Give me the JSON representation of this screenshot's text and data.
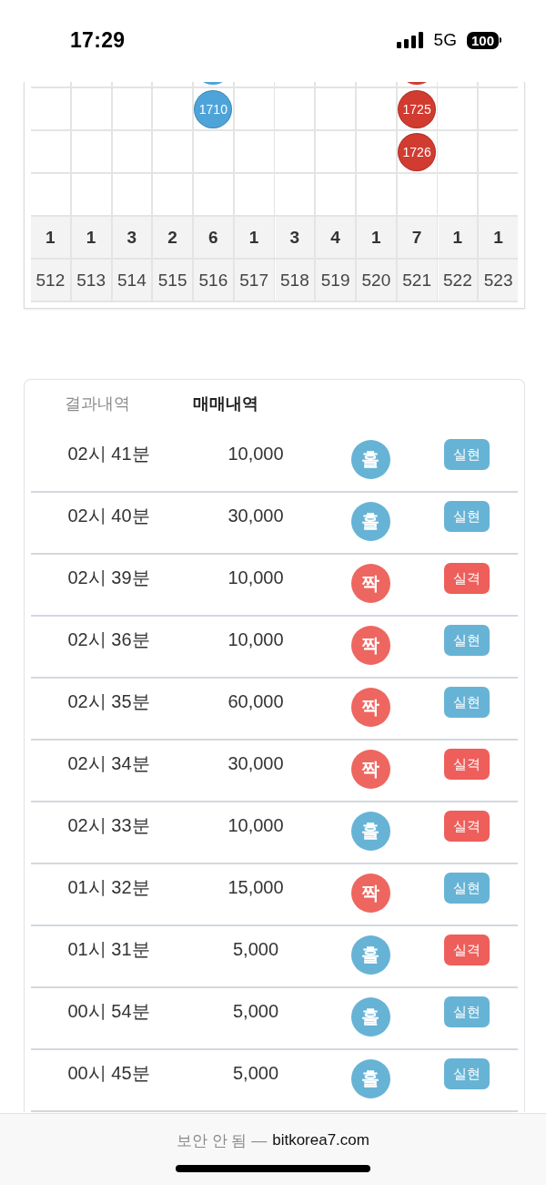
{
  "status_bar": {
    "time": "17:29",
    "network": "5G",
    "battery": "100"
  },
  "bead_grid": {
    "columns": [
      {
        "count": "1",
        "round": "512"
      },
      {
        "count": "1",
        "round": "513"
      },
      {
        "count": "3",
        "round": "514"
      },
      {
        "count": "2",
        "round": "515"
      },
      {
        "count": "6",
        "round": "516",
        "beads": [
          {
            "color": "#4ea4d9"
          },
          {
            "color": "#4ea4d9",
            "label": "1710"
          }
        ]
      },
      {
        "count": "1",
        "round": "517"
      },
      {
        "count": "3",
        "round": "518"
      },
      {
        "count": "4",
        "round": "519"
      },
      {
        "count": "1",
        "round": "520"
      },
      {
        "count": "7",
        "round": "521",
        "beads": [
          {
            "color": "#d13b30"
          },
          {
            "color": "#d13b30",
            "label": "1725"
          },
          {
            "color": "#d13b30",
            "label": "1726"
          }
        ]
      },
      {
        "count": "1",
        "round": "522"
      },
      {
        "count": "1",
        "round": "523"
      }
    ]
  },
  "history_card": {
    "tabs": [
      {
        "label": "결과내역",
        "selected": false
      },
      {
        "label": "매매내역",
        "selected": true
      }
    ],
    "rows": [
      {
        "time": "02시 41분",
        "amount": "10,000",
        "pick": {
          "label": "홀",
          "color": "#67b3d5"
        },
        "result": {
          "label": "실현",
          "color": "#67b3d5"
        }
      },
      {
        "time": "02시 40분",
        "amount": "30,000",
        "pick": {
          "label": "홀",
          "color": "#67b3d5"
        },
        "result": {
          "label": "실현",
          "color": "#67b3d5"
        }
      },
      {
        "time": "02시 39분",
        "amount": "10,000",
        "pick": {
          "label": "짝",
          "color": "#ee6660"
        },
        "result": {
          "label": "실격",
          "color": "#ee5e5a"
        }
      },
      {
        "time": "02시 36분",
        "amount": "10,000",
        "pick": {
          "label": "짝",
          "color": "#ee6660"
        },
        "result": {
          "label": "실현",
          "color": "#67b3d5"
        }
      },
      {
        "time": "02시 35분",
        "amount": "60,000",
        "pick": {
          "label": "짝",
          "color": "#ee6660"
        },
        "result": {
          "label": "실현",
          "color": "#67b3d5"
        }
      },
      {
        "time": "02시 34분",
        "amount": "30,000",
        "pick": {
          "label": "짝",
          "color": "#ee6660"
        },
        "result": {
          "label": "실격",
          "color": "#ee5e5a"
        }
      },
      {
        "time": "02시 33분",
        "amount": "10,000",
        "pick": {
          "label": "홀",
          "color": "#67b3d5"
        },
        "result": {
          "label": "실격",
          "color": "#ee5e5a"
        }
      },
      {
        "time": "01시 32분",
        "amount": "15,000",
        "pick": {
          "label": "짝",
          "color": "#ee6660"
        },
        "result": {
          "label": "실현",
          "color": "#67b3d5"
        }
      },
      {
        "time": "01시 31분",
        "amount": "5,000",
        "pick": {
          "label": "홀",
          "color": "#67b3d5"
        },
        "result": {
          "label": "실격",
          "color": "#ee5e5a"
        }
      },
      {
        "time": "00시 54분",
        "amount": "5,000",
        "pick": {
          "label": "홀",
          "color": "#67b3d5"
        },
        "result": {
          "label": "실현",
          "color": "#67b3d5"
        }
      },
      {
        "time": "00시 45분",
        "amount": "5,000",
        "pick": {
          "label": "홀",
          "color": "#67b3d5"
        },
        "result": {
          "label": "실현",
          "color": "#67b3d5"
        }
      }
    ]
  },
  "browser_bar": {
    "security": "보안 안 됨 —",
    "url": "bitkorea7.com"
  }
}
